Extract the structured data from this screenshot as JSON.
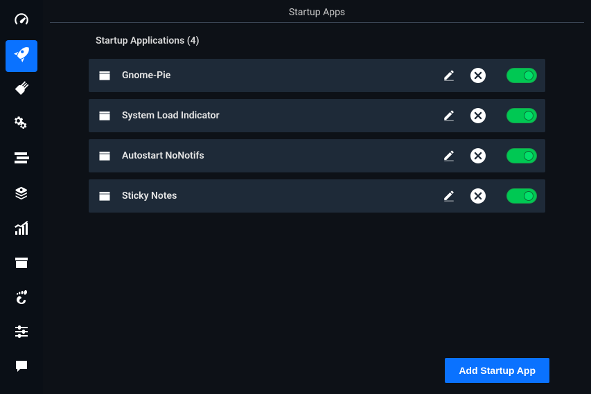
{
  "header": {
    "title": "Startup Apps"
  },
  "section": {
    "title": "Startup Applications (4)"
  },
  "apps": [
    {
      "name": "Gnome-Pie",
      "enabled": true
    },
    {
      "name": "System Load Indicator",
      "enabled": true
    },
    {
      "name": "Autostart NoNotifs",
      "enabled": true
    },
    {
      "name": "Sticky Notes",
      "enabled": true
    }
  ],
  "buttons": {
    "add": "Add Startup App"
  },
  "sidebar": [
    {
      "icon": "dashboard-icon",
      "active": false
    },
    {
      "icon": "rocket-icon",
      "active": true
    },
    {
      "icon": "broom-icon",
      "active": false
    },
    {
      "icon": "gears-icon",
      "active": false
    },
    {
      "icon": "stack-icon",
      "active": false
    },
    {
      "icon": "disc-icon",
      "active": false
    },
    {
      "icon": "chart-icon",
      "active": false
    },
    {
      "icon": "package-icon",
      "active": false
    },
    {
      "icon": "gnome-icon",
      "active": false
    },
    {
      "icon": "sliders-icon",
      "active": false
    },
    {
      "icon": "message-icon",
      "active": false
    }
  ]
}
